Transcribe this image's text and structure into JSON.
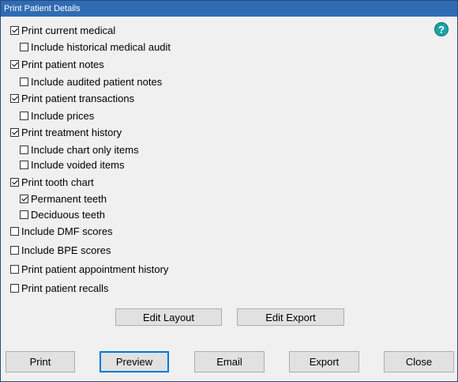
{
  "window": {
    "title": "Print Patient Details"
  },
  "help_icon": "question-mark-icon",
  "options": [
    {
      "id": "print-current-medical",
      "label": "Print current medical",
      "checked": true
    },
    {
      "id": "include-historical-medical-audit",
      "label": "Include historical medical audit",
      "checked": false
    },
    {
      "id": "print-patient-notes",
      "label": "Print patient notes",
      "checked": true
    },
    {
      "id": "include-audited-patient-notes",
      "label": "Include audited patient notes",
      "checked": false
    },
    {
      "id": "print-patient-transactions",
      "label": "Print patient transactions",
      "checked": true
    },
    {
      "id": "include-prices",
      "label": "Include prices",
      "checked": false
    },
    {
      "id": "print-treatment-history",
      "label": "Print treatment history",
      "checked": true
    },
    {
      "id": "include-chart-only-items",
      "label": "Include chart only items",
      "checked": false
    },
    {
      "id": "include-voided-items",
      "label": "Include voided items",
      "checked": false
    },
    {
      "id": "print-tooth-chart",
      "label": "Print tooth chart",
      "checked": true
    },
    {
      "id": "permanent-teeth",
      "label": "Permanent teeth",
      "checked": true
    },
    {
      "id": "deciduous-teeth",
      "label": "Deciduous teeth",
      "checked": false
    },
    {
      "id": "include-dmf-scores",
      "label": "Include DMF scores",
      "checked": false
    },
    {
      "id": "include-bpe-scores",
      "label": "Include BPE scores",
      "checked": false
    },
    {
      "id": "print-patient-appointment-history",
      "label": "Print patient appointment history",
      "checked": false
    },
    {
      "id": "print-patient-recalls",
      "label": "Print patient recalls",
      "checked": false
    }
  ],
  "layout_buttons": {
    "edit_layout": "Edit Layout",
    "edit_export": "Edit Export"
  },
  "footer_buttons": {
    "print": "Print",
    "preview": "Preview",
    "email": "Email",
    "export": "Export",
    "close": "Close"
  }
}
